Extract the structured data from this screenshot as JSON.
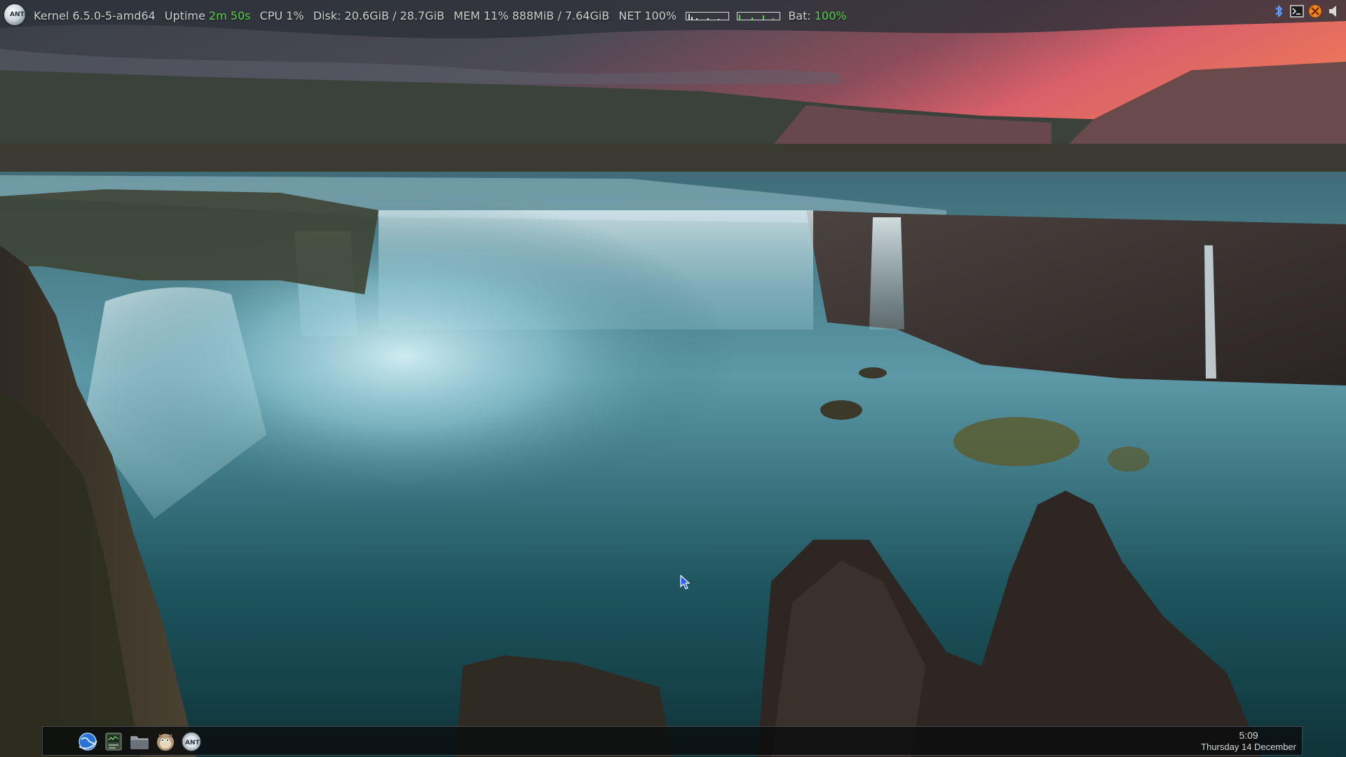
{
  "topbar": {
    "kernel": "Kernel 6.5.0-5-amd64",
    "uptime_label": "Uptime",
    "uptime_value": "2m 50s",
    "cpu": "CPU 1%",
    "disk": "Disk: 20.6GiB / 28.7GiB",
    "mem": "MEM 11% 888MiB / 7.64GiB",
    "net": "NET 100%",
    "bat_label": "Bat:",
    "bat_value": "100%"
  },
  "dock": {
    "launchers": [
      "browser-icon",
      "system-monitor-icon",
      "file-manager-icon",
      "gimp-icon",
      "antix-menu-icon"
    ],
    "clock_time": "5:09",
    "clock_date": "Thursday 14 December"
  },
  "tray": {
    "icons": [
      "bluetooth-icon",
      "terminal-icon",
      "network-icon",
      "volume-icon"
    ]
  },
  "colors": {
    "accent_green": "#58d14c",
    "text": "#c9d1cf"
  }
}
